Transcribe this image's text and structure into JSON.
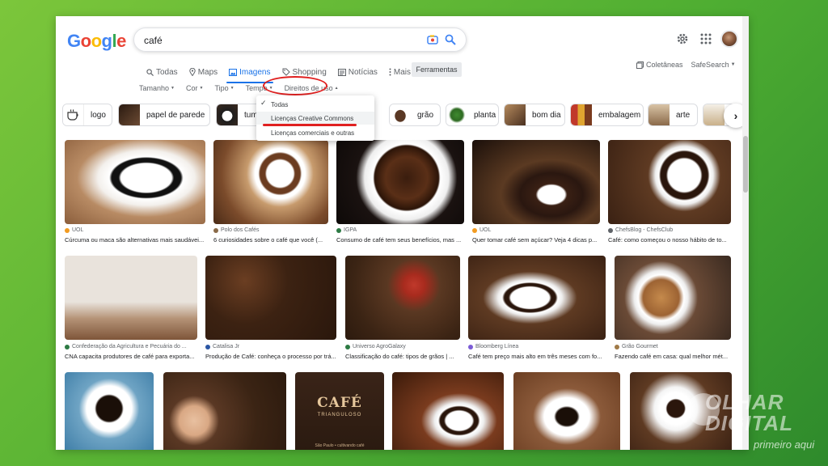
{
  "logo": "Google",
  "search": {
    "query": "café"
  },
  "tabs": [
    {
      "label": "Todas",
      "icon": "search-icon"
    },
    {
      "label": "Maps",
      "icon": "map-pin-icon"
    },
    {
      "label": "Imagens",
      "icon": "image-icon",
      "active": true
    },
    {
      "label": "Shopping",
      "icon": "tag-icon"
    },
    {
      "label": "Notícias",
      "icon": "news-icon"
    },
    {
      "label": "Mais",
      "icon": "more-vert-icon"
    }
  ],
  "tools_label": "Ferramentas",
  "right_links": {
    "collections": "Coletâneas",
    "safesearch": "SafeSearch"
  },
  "filters": [
    "Tamanho",
    "Cor",
    "Tipo",
    "Tempo",
    "Direitos de uso"
  ],
  "dropdown": {
    "items": [
      "Todas",
      "Licenças Creative Commons",
      "Licenças comerciais e outras"
    ],
    "checked_index": 0,
    "highlighted_index": 1
  },
  "chips": [
    {
      "label": "logo"
    },
    {
      "label": "papel de parede"
    },
    {
      "label": "tumbl"
    },
    {
      "label": "grão"
    },
    {
      "label": "planta"
    },
    {
      "label": "bom dia"
    },
    {
      "label": "embalagem"
    },
    {
      "label": "arte"
    }
  ],
  "results": [
    {
      "source": "UOL",
      "title": "Cúrcuma ou maca são alternativas mais saudávei..."
    },
    {
      "source": "Polo dos Cafés",
      "title": "6 curiosidades sobre o café que você (..."
    },
    {
      "source": "IGPA",
      "title": "Consumo de café tem seus benefícios, mas ..."
    },
    {
      "source": "UOL",
      "title": "Quer tomar café sem açúcar? Veja 4 dicas p..."
    },
    {
      "source": "ChefsBlog - ChefsClub",
      "title": "Café: como começou o nosso hábito de to..."
    },
    {
      "source": "Confederação da Agricultura e Pecuária do ...",
      "title": "CNA capacita produtores de café para exporta..."
    },
    {
      "source": "Catalisa Jr",
      "title": "Produção de Café: conheça o processo por trá..."
    },
    {
      "source": "Universo AgroGalaxy",
      "title": "Classificação do café: tipos de grãos | ..."
    },
    {
      "source": "Bloomberg Línea",
      "title": "Café tem preço mais alto em três meses com fo..."
    },
    {
      "source": "Grão Gourmet",
      "title": "Fazendo café em casa: qual melhor mét..."
    }
  ],
  "row3_art_text": {
    "line1": "CAFÉ",
    "line2": "TRIANGULOSO",
    "line3": "São Paulo • cultivando café"
  },
  "watermark": {
    "line1": "OLHAR",
    "line2": "DIGITAL",
    "tagline": "primeiro aqui"
  },
  "colors": {
    "accent": "#1a73e8",
    "annotation_red": "#e02020",
    "bg_green": "#4fae32"
  }
}
